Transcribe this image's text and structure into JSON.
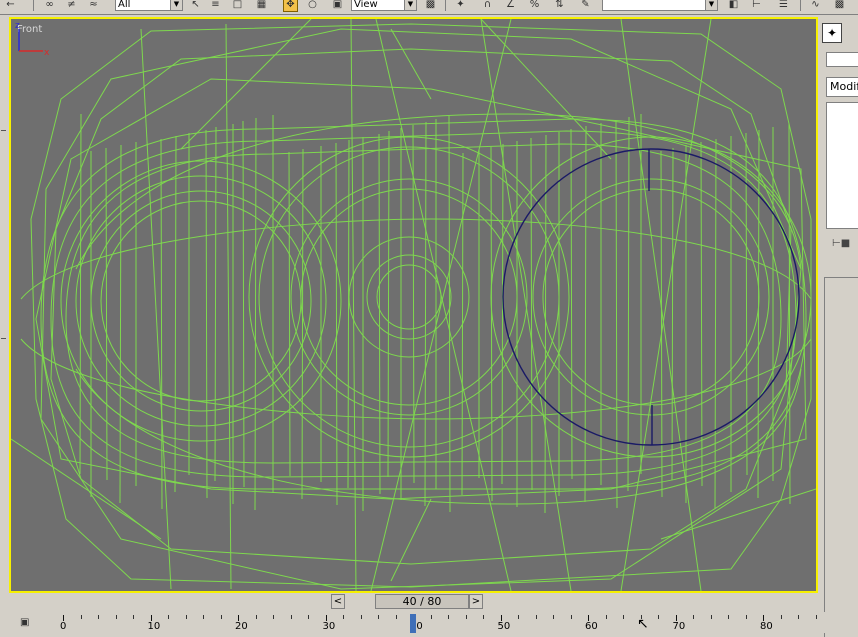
{
  "toolbar": {
    "selection_filter_value": "All",
    "reference_coord_value": "View",
    "buttons": [
      "undo-icon",
      "redo-icon",
      "link-icon",
      "unlink-icon",
      "bind-space-warp-icon",
      "select-icon",
      "select-by-name-icon",
      "rect-region-icon",
      "window-crossing-icon",
      "select-move-icon",
      "select-rotate-icon",
      "select-scale-icon",
      "pivot-icon",
      "mirror-icon",
      "align-icon",
      "snap-icon",
      "angle-snap-icon",
      "percent-snap-icon",
      "spinner-snap-icon",
      "edit-named-selection-icon",
      "mirror-icon-2",
      "align-icon-2",
      "layer-icon",
      "curve-editor-icon",
      "schematic-view-icon"
    ]
  },
  "viewport": {
    "label": "Front",
    "border_color": "#f6f000",
    "background": "#6f6f6f",
    "wire_color": "#7ed84e",
    "selected_wire_color": "#1a1a66",
    "axis": {
      "z": "z",
      "x": "x"
    }
  },
  "command_panel": {
    "modifier_dropdown": "Modifi",
    "active_tab_icon": "create-icon"
  },
  "time_slider": {
    "frame_text": "40 / 80",
    "prev_label": "<",
    "next_label": ">",
    "current_frame": 40,
    "total_frames": 80
  },
  "track_bar": {
    "labels": [
      "0",
      "10",
      "20",
      "30",
      "40",
      "50",
      "60",
      "70",
      "80"
    ],
    "current_frame": 40
  }
}
